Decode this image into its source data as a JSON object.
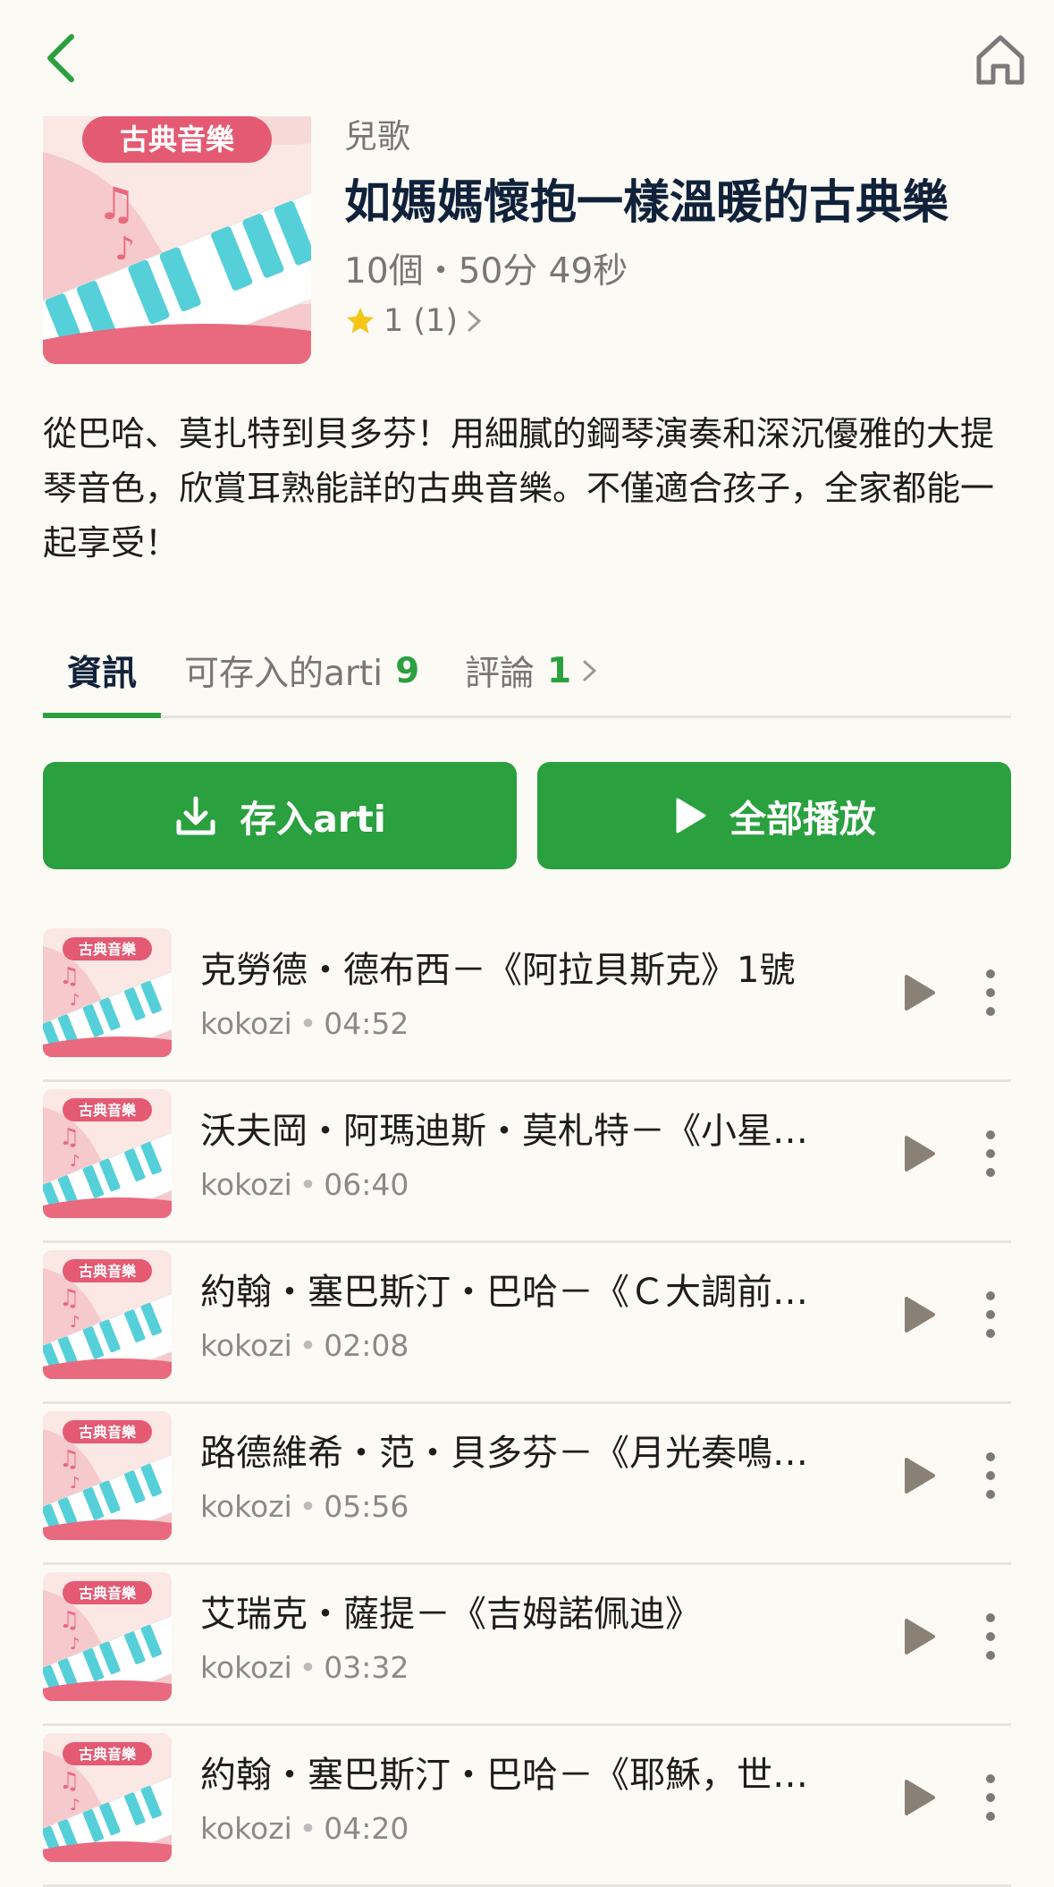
{
  "colors": {
    "accent": "#2aa03f",
    "title": "#10223a",
    "background": "#fcfaf5",
    "muted": "#777777"
  },
  "nav": {
    "back_icon": "chevron-left-icon",
    "home_icon": "home-icon"
  },
  "album": {
    "cover_label": "古典音樂",
    "genre": "兒歌",
    "title": "如媽媽懷抱一樣溫暖的古典樂",
    "count_duration": "10個・50分 49秒",
    "rating_text": "1 (1)",
    "description": "從巴哈、莫扎特到貝多芬！用細膩的鋼琴演奏和深沉優雅的大提琴音色，欣賞耳熟能詳的古典音樂。不僅適合孩子，全家都能一起享受！"
  },
  "tabs": [
    {
      "label": "資訊",
      "count": ""
    },
    {
      "label": "可存入的arti",
      "count": "9"
    },
    {
      "label": "評論",
      "count": "1"
    }
  ],
  "actions": {
    "save_label": "存入arti",
    "play_all_label": "全部播放"
  },
  "tracks": [
    {
      "title": "克勞德・德布西－《阿拉貝斯克》1號",
      "artist": "kokozi",
      "duration": "04:52",
      "cover_label": "古典音樂"
    },
    {
      "title": "沃夫岡・阿瑪迪斯・莫札特－《小星…",
      "artist": "kokozi",
      "duration": "06:40",
      "cover_label": "古典音樂"
    },
    {
      "title": "約翰・塞巴斯汀・巴哈－《Ｃ大調前…",
      "artist": "kokozi",
      "duration": "02:08",
      "cover_label": "古典音樂"
    },
    {
      "title": "路德維希・范・貝多芬－《月光奏鳴…",
      "artist": "kokozi",
      "duration": "05:56",
      "cover_label": "古典音樂"
    },
    {
      "title": "艾瑞克・薩提－《吉姆諾佩迪》",
      "artist": "kokozi",
      "duration": "03:32",
      "cover_label": "古典音樂"
    },
    {
      "title": "約翰・塞巴斯汀・巴哈－《耶穌，世…",
      "artist": "kokozi",
      "duration": "04:20",
      "cover_label": "古典音樂"
    }
  ]
}
